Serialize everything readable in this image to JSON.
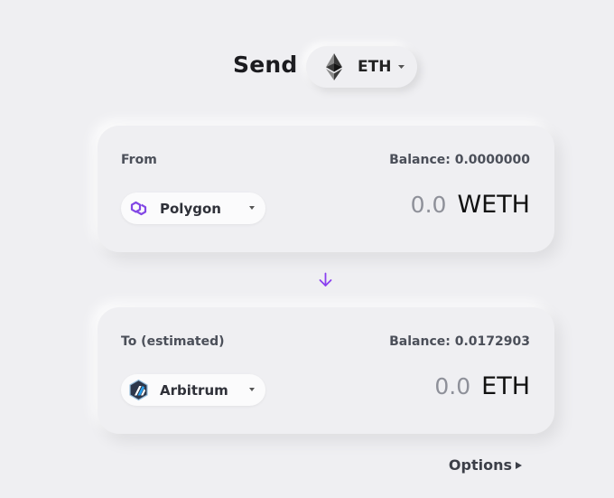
{
  "header": {
    "title": "Send",
    "token": {
      "symbol": "ETH",
      "icon": "ethereum-icon"
    }
  },
  "from": {
    "label": "From",
    "balance": "Balance: 0.0000000",
    "chain": {
      "name": "Polygon",
      "icon": "polygon-icon"
    },
    "amount": "0.0",
    "unit": "WETH"
  },
  "swap_arrow": {
    "icon": "arrow-down-icon",
    "color": "#8a3ff0"
  },
  "to": {
    "label": "To (estimated)",
    "balance": "Balance: 0.0172903",
    "chain": {
      "name": "Arbitrum",
      "icon": "arbitrum-icon"
    },
    "amount": "0.0",
    "unit": "ETH"
  },
  "options": {
    "label": "Options",
    "icon": "triangle-right-icon"
  },
  "colors": {
    "background": "#efeff2",
    "accent_purple": "#8247e5",
    "text_primary": "#111111",
    "text_muted": "#8e9099"
  }
}
